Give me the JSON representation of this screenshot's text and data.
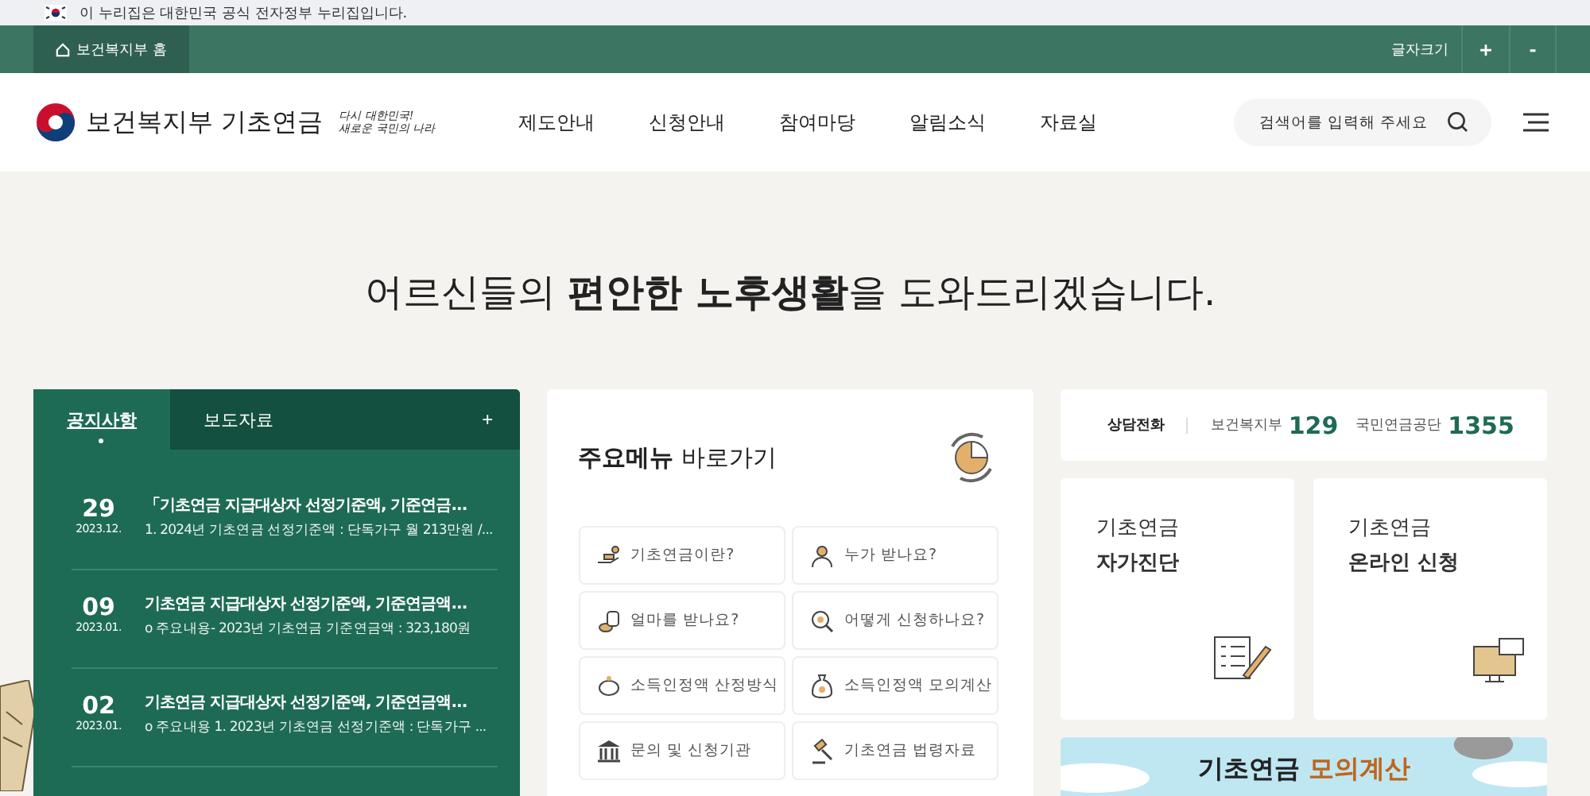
{
  "gov_banner": {
    "text": "이 누리집은 대한민국 공식 전자정부 누리집입니다."
  },
  "utility_bar": {
    "home_link": "보건복지부 홈",
    "font_size_label": "글자크기",
    "buttons": [
      "+",
      "-"
    ]
  },
  "header": {
    "logo_text": "보건복지부 기초연금",
    "slogan": [
      "다시 대한민국!",
      "새로운 국민의 나라"
    ],
    "nav": [
      {
        "label": "제도안내"
      },
      {
        "label": "신청안내"
      },
      {
        "label": "참여마당"
      },
      {
        "label": "알림소식"
      },
      {
        "label": "자료실"
      }
    ],
    "search": {
      "placeholder": "검색어를 입력해 주세요"
    }
  },
  "hero": {
    "headline": "어르신들의 **편안한 노후생활**을 도와드리겠습니다."
  },
  "news": {
    "tabs": [
      {
        "label": "공지사항",
        "selected": true
      },
      {
        "label": "보도자료",
        "selected": false
      }
    ],
    "more": "+",
    "items": [
      {
        "day": "29",
        "month": "2023.12.",
        "title": "「기초연금 지급대상자 선정기준액, 기준연금...",
        "summary": "1. 2024년 기초연금 선정기준액 : 단독가구 월 213만원 /..."
      },
      {
        "day": "09",
        "month": "2023.01.",
        "title": "기초연금 지급대상자 선정기준액, 기준연금액...",
        "summary": "o 주요내용- 2023년 기초연금 기준연금액 : 323,180원"
      },
      {
        "day": "02",
        "month": "2023.01.",
        "title": "기초연금 지급대상자 선정기준액, 기준연금액...",
        "summary": "o 주요내용 1. 2023년 기초연금 선정기준액 : 단독가구 ..."
      }
    ]
  },
  "quick_menu": {
    "title_bold": "주요메뉴",
    "title_rest": "바로가기",
    "items": [
      {
        "label": "기초연금이란?",
        "kind": "coins-hand"
      },
      {
        "label": "누가 받나요?",
        "kind": "person"
      },
      {
        "label": "얼마를 받나요?",
        "kind": "coins"
      },
      {
        "label": "어떻게 신청하나요?",
        "kind": "magnifier"
      },
      {
        "label": "소득인정액 산정방식",
        "kind": "piggy"
      },
      {
        "label": "소득인정액 모의계산",
        "kind": "moneybag"
      },
      {
        "label": "문의 및 신청기관",
        "kind": "bank"
      },
      {
        "label": "기초연금 법령자료",
        "kind": "gavel"
      }
    ]
  },
  "hotline": {
    "label": "상담전화",
    "entries": [
      {
        "org": "보건복지부",
        "number": "129"
      },
      {
        "org": "국민연금공단",
        "number": "1355"
      }
    ]
  },
  "service_cards": [
    {
      "line1": "기초연금",
      "line2": "자가진단",
      "kind": "checklist"
    },
    {
      "line1": "기초연금",
      "line2": "온라인 신청",
      "kind": "monitor"
    }
  ],
  "banner": {
    "title": "기초연금",
    "title_highlight": "모의계산"
  }
}
